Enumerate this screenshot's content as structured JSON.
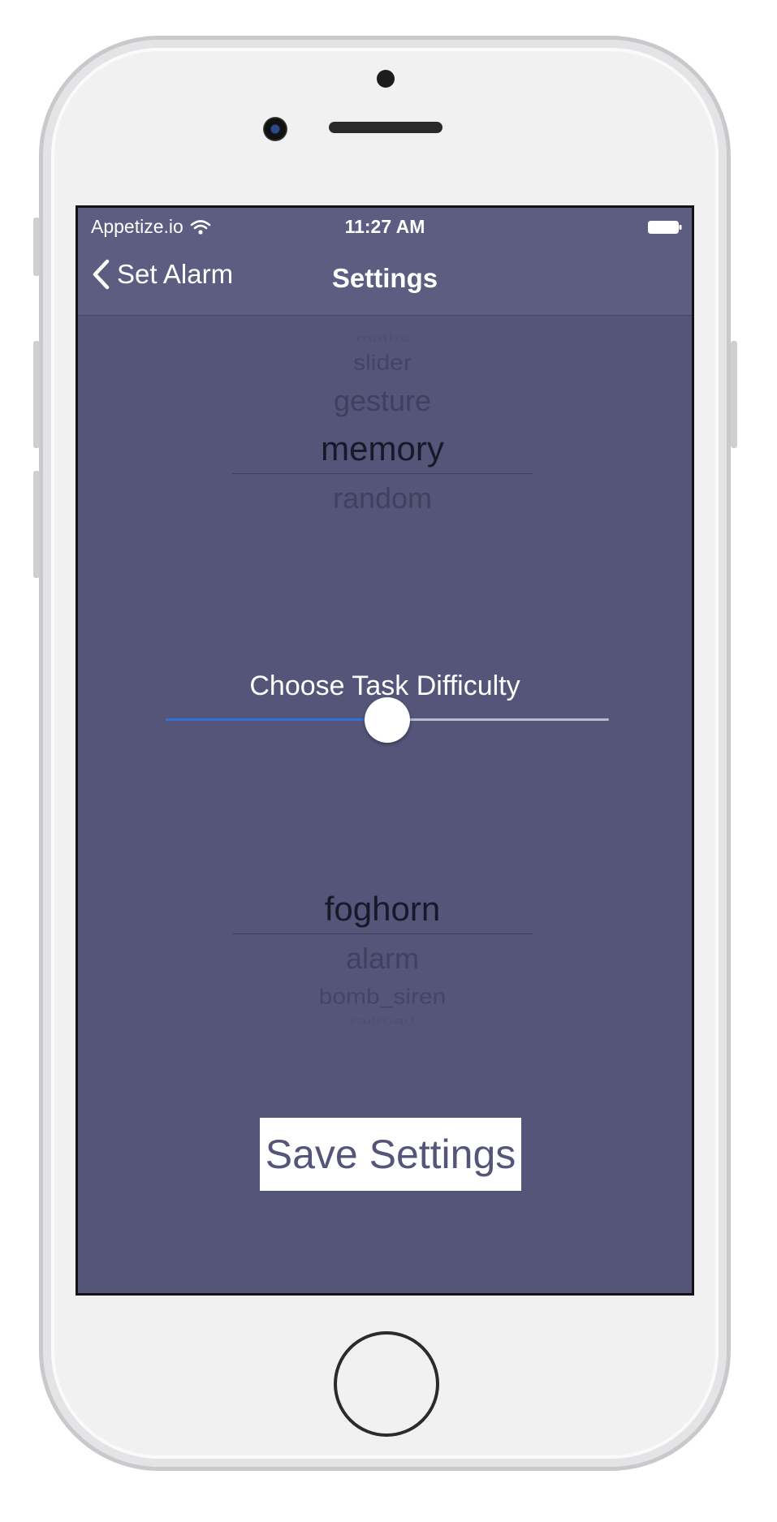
{
  "status_bar": {
    "carrier": "Appetize.io",
    "time": "11:27 AM"
  },
  "nav_bar": {
    "back_label": "Set Alarm",
    "title": "Settings"
  },
  "task_picker": {
    "items": [
      "maths",
      "slider",
      "gesture",
      "memory",
      "random"
    ],
    "selected": "memory"
  },
  "difficulty": {
    "label": "Choose Task Difficulty",
    "value": 0.5,
    "track_fill_color": "#2f6fd8"
  },
  "sound_picker": {
    "items": [
      "foghorn",
      "alarm",
      "bomb_siren",
      "railroad"
    ],
    "selected": "foghorn"
  },
  "save_button": {
    "label": "Save Settings"
  },
  "colors": {
    "screen_background": "#545579",
    "nav_background": "#5c5d81"
  }
}
